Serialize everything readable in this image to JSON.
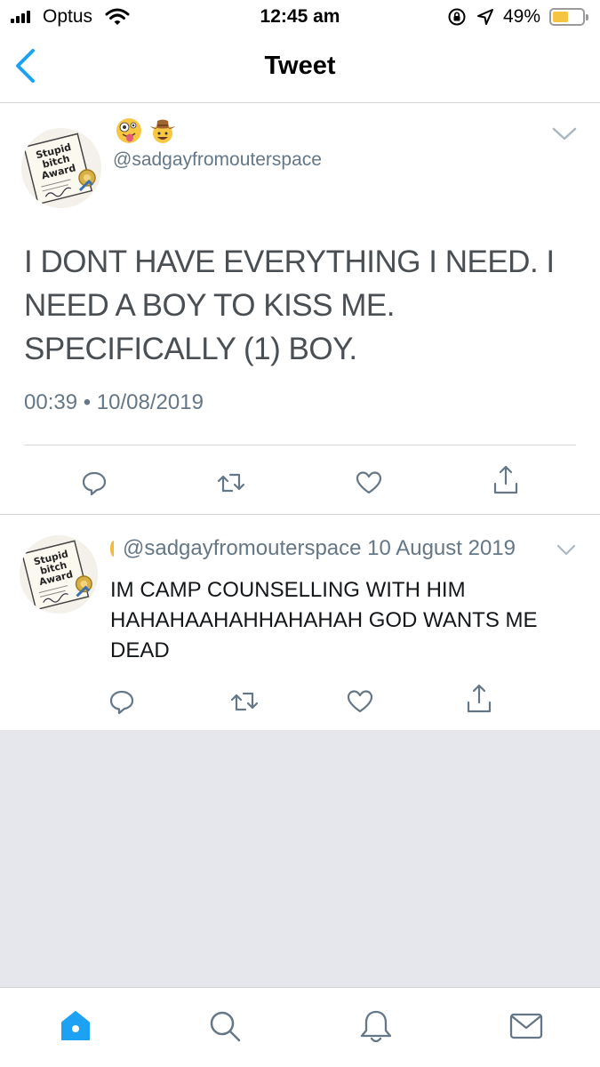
{
  "status_bar": {
    "carrier": "Optus",
    "time": "12:45 am",
    "battery_percent": "49%",
    "battery_level": 0.49,
    "battery_color": "#f5c542"
  },
  "nav": {
    "title": "Tweet",
    "back_icon": "chevron-left-icon",
    "accent": "#1da1f2"
  },
  "main_tweet": {
    "display_name_emojis": [
      "zany-face-emoji",
      "cowboy-face-emoji"
    ],
    "avatar_text": [
      "Stupid",
      "bitch",
      "Award"
    ],
    "handle": "@sadgayfromouterspace",
    "text": "I DONT HAVE EVERYTHING I NEED. I NEED A BOY TO KISS ME. SPECIFICALLY (1) BOY.",
    "timestamp": "00:39 • 10/08/2019",
    "actions": [
      "reply-icon",
      "retweet-icon",
      "like-icon",
      "share-icon"
    ]
  },
  "reply_tweet": {
    "avatar_text": [
      "Stupid",
      "bitch",
      "Award"
    ],
    "handle": "@sadgayfromouterspace",
    "date": "10 August 2019",
    "text": "IM CAMP COUNSELLING WITH HIM HAHAHAAHAHHAHAHAH GOD WANTS ME DEAD",
    "actions": [
      "reply-icon",
      "retweet-icon",
      "like-icon",
      "share-icon"
    ]
  },
  "tab_bar": {
    "tabs": [
      "home-icon",
      "search-icon",
      "notifications-icon",
      "messages-icon"
    ],
    "active": "home-icon",
    "active_color": "#1da1f2",
    "inactive_color": "#657786"
  }
}
